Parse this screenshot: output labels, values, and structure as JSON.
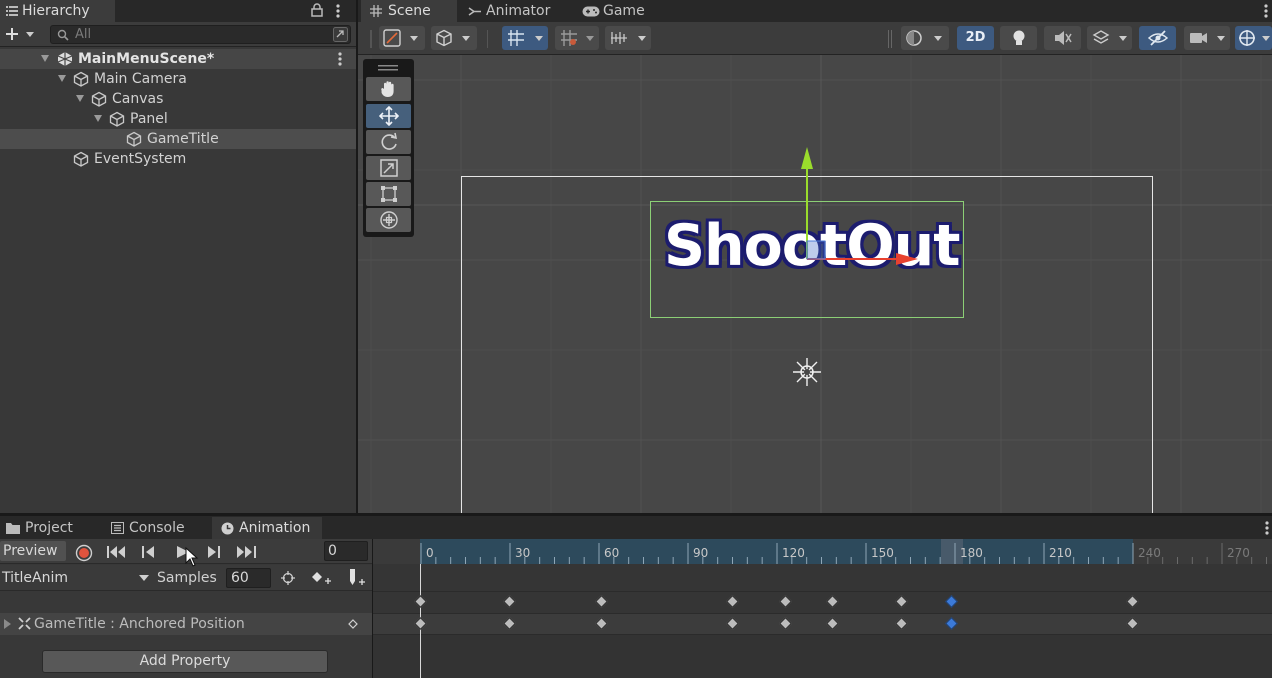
{
  "hierarchy": {
    "tab_label": "Hierarchy",
    "search_placeholder": "All",
    "scene_name": "MainMenuScene*",
    "nodes": [
      {
        "label": "Main Camera"
      },
      {
        "label": "Canvas"
      },
      {
        "label": "Panel"
      },
      {
        "label": "GameTitle"
      },
      {
        "label": "EventSystem"
      }
    ]
  },
  "scene": {
    "tabs": [
      {
        "label": "Scene"
      },
      {
        "label": "Animator"
      },
      {
        "label": "Game"
      }
    ],
    "toolbar": {
      "mode_2d_label": "2D"
    },
    "title_text": "ShootOut"
  },
  "bottom_panel": {
    "tabs": [
      {
        "label": "Project"
      },
      {
        "label": "Console"
      },
      {
        "label": "Animation"
      }
    ]
  },
  "animation": {
    "preview_label": "Preview",
    "frame_value": "0",
    "clip_name": "TitleAnim",
    "samples_label": "Samples",
    "samples_value": "60",
    "property_label": "GameTitle : Anchored Position",
    "add_property_label": "Add Property",
    "ruler_ticks": [
      "0",
      "30",
      "60",
      "90",
      "120",
      "150",
      "180",
      "210",
      "240",
      "270"
    ],
    "keyframes": [
      0,
      30,
      61,
      105,
      123,
      139,
      162,
      179,
      240
    ],
    "selected_keyframe": 179,
    "colors": {
      "record": "#e0533d",
      "selected_key": "#3c7ad8",
      "ruler_active": "#2d4a5c",
      "gizmo_y": "#9adc2c",
      "gizmo_x": "#e8412f"
    }
  }
}
